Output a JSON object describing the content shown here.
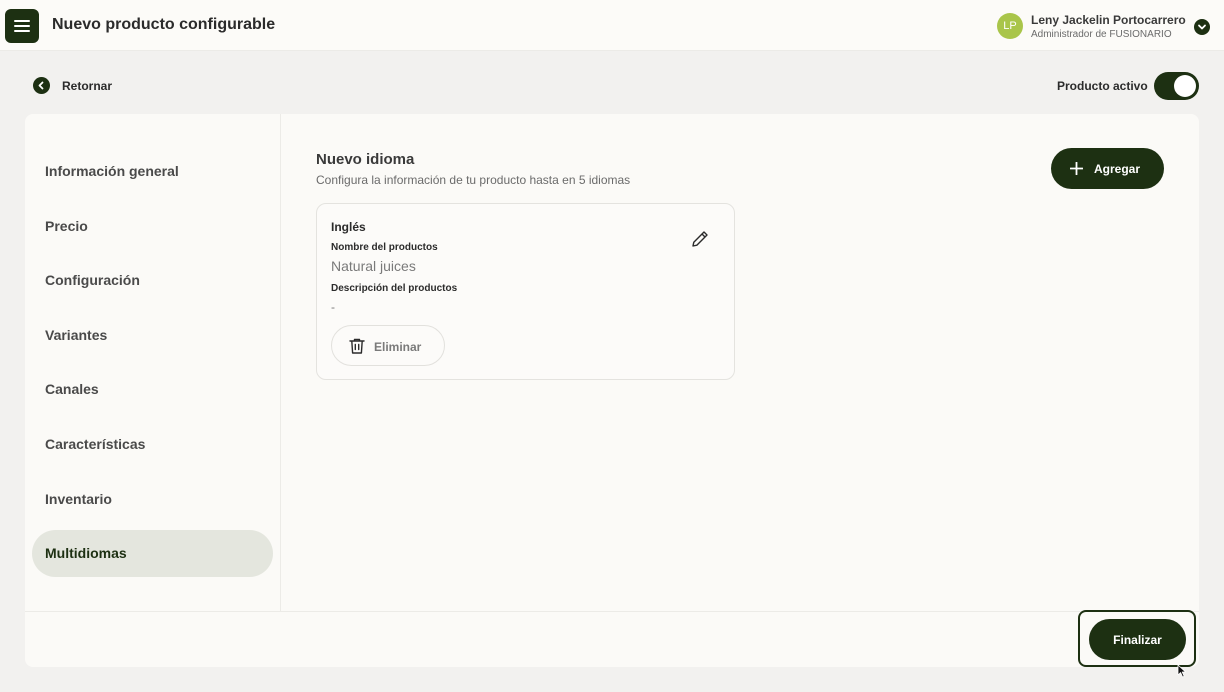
{
  "header": {
    "title": "Nuevo producto configurable",
    "menu_icon": "hamburger-menu-icon",
    "user": {
      "initials": "LP",
      "name": "Leny Jackelin Portocarrero",
      "role": "Administrador de FUSIONARIO",
      "avatar_color": "#a9c54a"
    }
  },
  "toolbar": {
    "back_label": "Retornar",
    "active_label": "Producto activo",
    "active": true
  },
  "sidebar": {
    "items": [
      {
        "label": "Información general",
        "active": false
      },
      {
        "label": "Precio",
        "active": false
      },
      {
        "label": "Configuración",
        "active": false
      },
      {
        "label": "Variantes",
        "active": false
      },
      {
        "label": "Canales",
        "active": false
      },
      {
        "label": "Características",
        "active": false
      },
      {
        "label": "Inventario",
        "active": false
      },
      {
        "label": "Multidiomas",
        "active": true
      }
    ]
  },
  "main": {
    "title": "Nuevo idioma",
    "subtitle": "Configura la información de tu producto hasta en 5 idiomas",
    "add_label": "Agregar",
    "languages": [
      {
        "name": "Inglés",
        "name_label": "Nombre del productos",
        "name_value": "Natural juices",
        "description_label": "Descripción del productos",
        "description_value": "-",
        "delete_label": "Eliminar"
      }
    ]
  },
  "footer": {
    "finish_label": "Finalizar"
  },
  "colors": {
    "primary": "#1d3012",
    "background": "#f2f1ef",
    "card": "#fbfaf7",
    "active_nav": "#e4e6de"
  }
}
